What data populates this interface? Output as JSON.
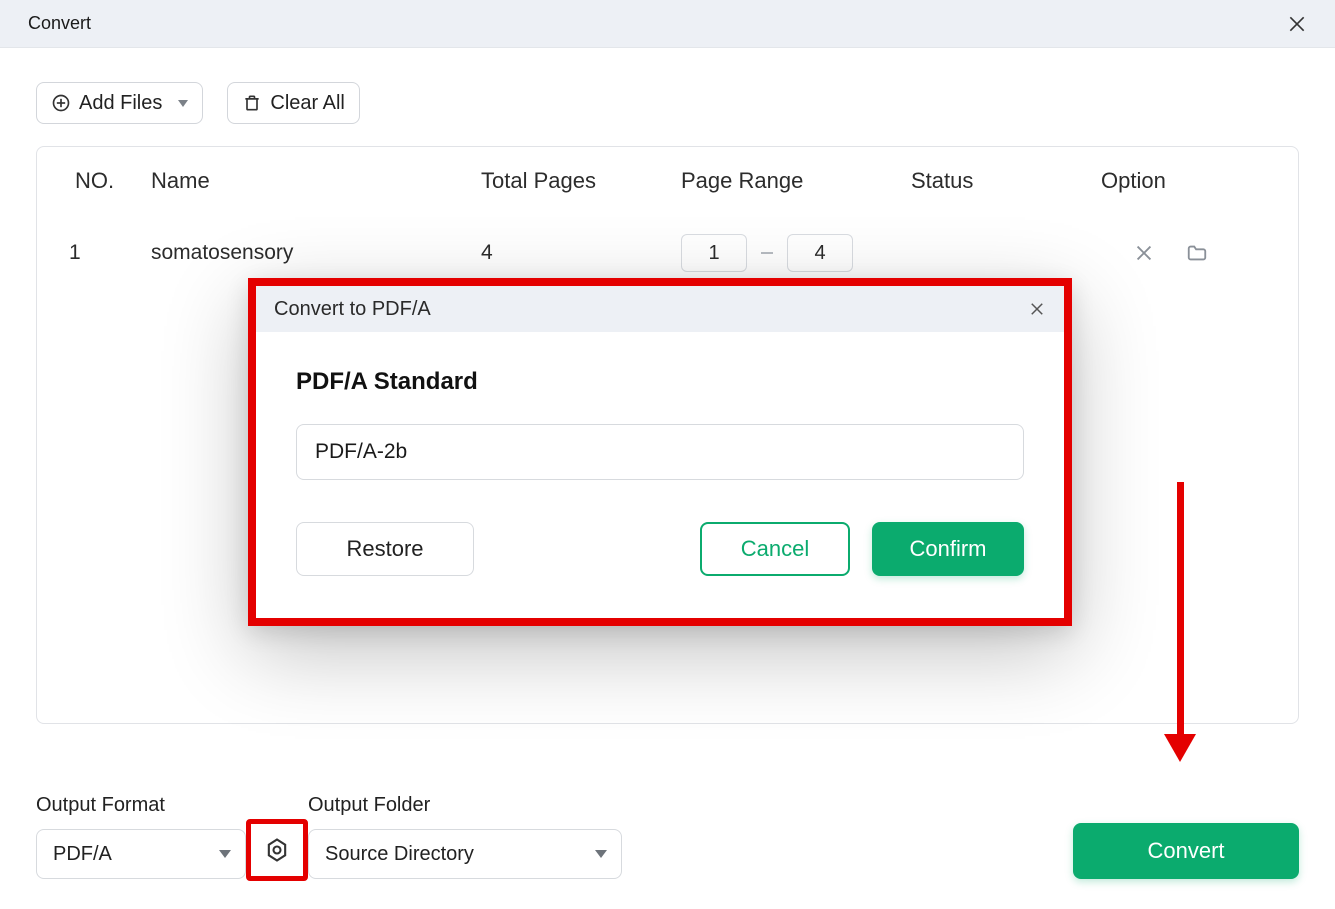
{
  "window": {
    "title": "Convert"
  },
  "toolbar": {
    "add_files_label": "Add Files",
    "clear_all_label": "Clear All"
  },
  "table": {
    "headers": {
      "no": "NO.",
      "name": "Name",
      "total_pages": "Total Pages",
      "page_range": "Page Range",
      "status": "Status",
      "option": "Option"
    },
    "rows": [
      {
        "no": "1",
        "name": "somatosensory",
        "total_pages": "4",
        "range_from": "1",
        "range_to": "4",
        "status": ""
      }
    ]
  },
  "footer": {
    "output_format_label": "Output Format",
    "output_format_value": "PDF/A",
    "output_folder_label": "Output Folder",
    "output_folder_value": "Source Directory",
    "convert_label": "Convert"
  },
  "modal": {
    "title": "Convert to PDF/A",
    "standard_label": "PDF/A Standard",
    "standard_value": "PDF/A-2b",
    "restore_label": "Restore",
    "cancel_label": "Cancel",
    "confirm_label": "Confirm"
  },
  "colors": {
    "accent": "#0bab6e",
    "annotation": "#e40000"
  }
}
